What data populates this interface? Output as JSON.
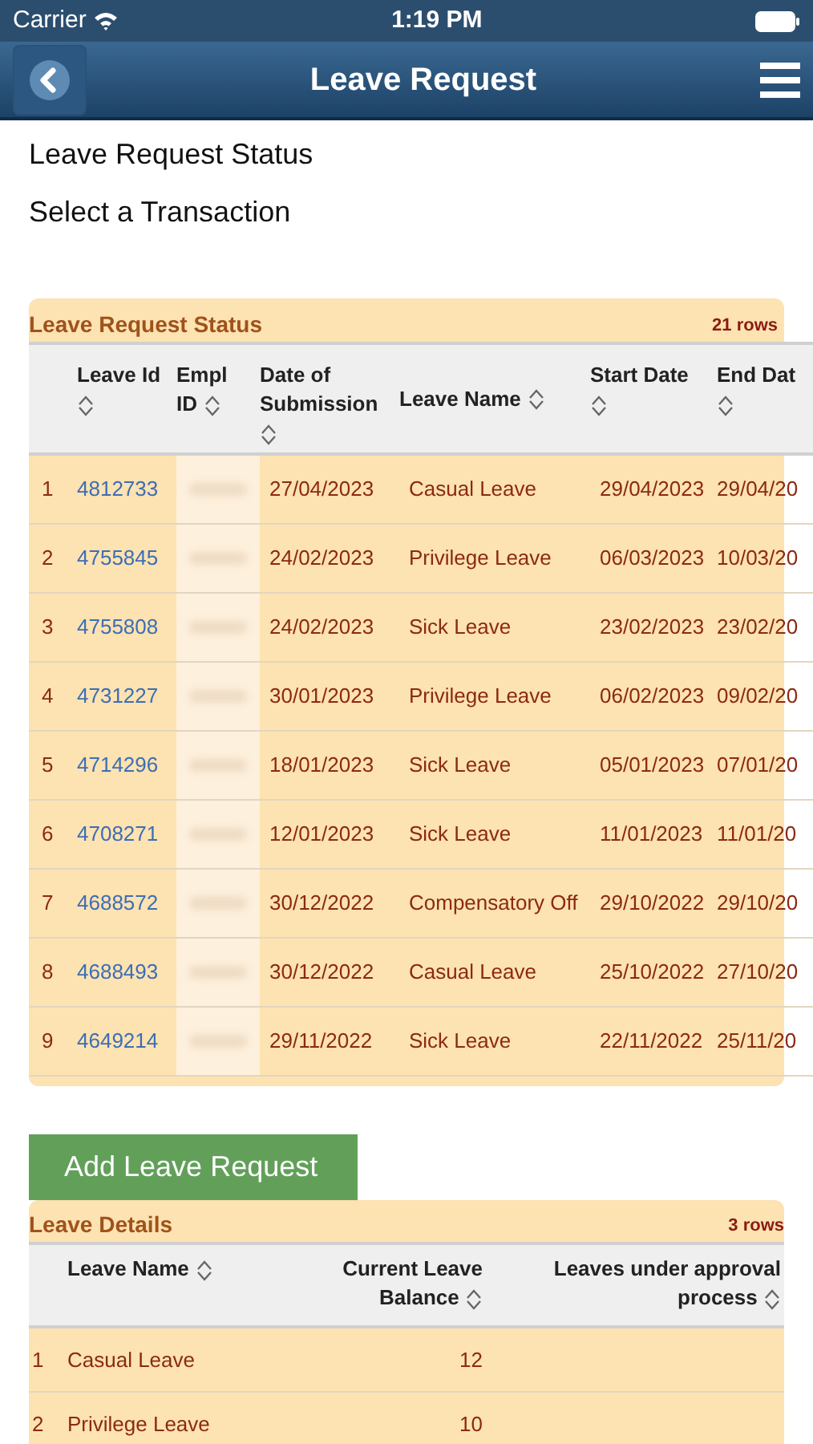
{
  "status_bar": {
    "carrier": "Carrier",
    "time": "1:19 PM"
  },
  "nav_bar": {
    "title": "Leave Request"
  },
  "links": [
    "Leave Request Status",
    "Select a Transaction"
  ],
  "status_table": {
    "title": "Leave Request Status",
    "row_count": "21 rows",
    "columns": [
      {
        "label": "Leave Id"
      },
      {
        "label": "Empl ID"
      },
      {
        "label": "Date of Submission"
      },
      {
        "label": "Leave Name"
      },
      {
        "label": "Start Date"
      },
      {
        "label": "End Dat"
      }
    ],
    "rows": [
      {
        "index": "1",
        "leave_id": "4812733",
        "submitted": "27/04/2023",
        "leave_name": "Casual Leave",
        "start": "29/04/2023",
        "end": "29/04/20"
      },
      {
        "index": "2",
        "leave_id": "4755845",
        "submitted": "24/02/2023",
        "leave_name": "Privilege Leave",
        "start": "06/03/2023",
        "end": "10/03/20"
      },
      {
        "index": "3",
        "leave_id": "4755808",
        "submitted": "24/02/2023",
        "leave_name": "Sick Leave",
        "start": "23/02/2023",
        "end": "23/02/20"
      },
      {
        "index": "4",
        "leave_id": "4731227",
        "submitted": "30/01/2023",
        "leave_name": "Privilege Leave",
        "start": "06/02/2023",
        "end": "09/02/20"
      },
      {
        "index": "5",
        "leave_id": "4714296",
        "submitted": "18/01/2023",
        "leave_name": "Sick Leave",
        "start": "05/01/2023",
        "end": "07/01/20"
      },
      {
        "index": "6",
        "leave_id": "4708271",
        "submitted": "12/01/2023",
        "leave_name": "Sick Leave",
        "start": "11/01/2023",
        "end": "11/01/20"
      },
      {
        "index": "7",
        "leave_id": "4688572",
        "submitted": "30/12/2022",
        "leave_name": "Compensatory Off",
        "start": "29/10/2022",
        "end": "29/10/20"
      },
      {
        "index": "8",
        "leave_id": "4688493",
        "submitted": "30/12/2022",
        "leave_name": "Casual Leave",
        "start": "25/10/2022",
        "end": "27/10/20"
      },
      {
        "index": "9",
        "leave_id": "4649214",
        "submitted": "29/11/2022",
        "leave_name": "Sick Leave",
        "start": "22/11/2022",
        "end": "25/11/20"
      }
    ]
  },
  "add_button": "Add Leave Request",
  "details_table": {
    "title": "Leave Details",
    "row_count": "3 rows",
    "columns": [
      {
        "label": "Leave Name"
      },
      {
        "label": "Current Leave Balance"
      },
      {
        "label": "Leaves under approval process"
      }
    ],
    "rows": [
      {
        "index": "1",
        "leave_name": "Casual Leave",
        "balance": "12"
      },
      {
        "index": "2",
        "leave_name": "Privilege Leave",
        "balance": "10"
      }
    ]
  }
}
